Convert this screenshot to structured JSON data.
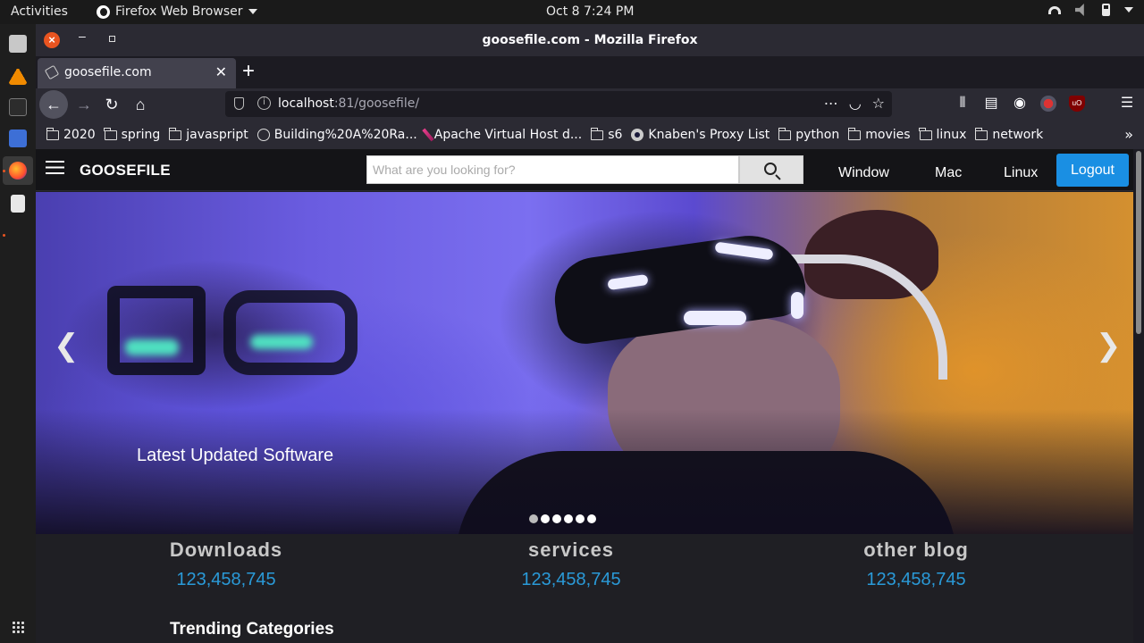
{
  "system": {
    "activities": "Activities",
    "app_menu": "Firefox Web Browser",
    "clock": "Oct 8   7:24 PM"
  },
  "window": {
    "title": "goosefile.com - Mozilla Firefox"
  },
  "tabs": [
    {
      "label": "goosefile.com"
    }
  ],
  "urlbar": {
    "host": "localhost",
    "rest": ":81/goosefile/"
  },
  "bookmarks": [
    {
      "label": "2020",
      "icon": "folder-icon"
    },
    {
      "label": "spring",
      "icon": "folder-icon"
    },
    {
      "label": "javaspript",
      "icon": "folder-icon"
    },
    {
      "label": "Building%20A%20Ra...",
      "icon": "globe-icon"
    },
    {
      "label": "Apache Virtual Host d...",
      "icon": "feather-icon"
    },
    {
      "label": "s6",
      "icon": "folder-icon"
    },
    {
      "label": "Knaben's Proxy List",
      "icon": "knaben-icon"
    },
    {
      "label": "python",
      "icon": "folder-icon"
    },
    {
      "label": "movies",
      "icon": "folder-icon"
    },
    {
      "label": "linux",
      "icon": "folder-icon"
    },
    {
      "label": "network",
      "icon": "folder-icon"
    }
  ],
  "site": {
    "brand": "GOOSEFILE",
    "search_placeholder": "What are you looking for?",
    "nav": {
      "window": "Window",
      "mac": "Mac",
      "linux": "Linux",
      "logout": "Logout"
    },
    "hero": {
      "caption": "Latest Updated Software",
      "prev": "❮",
      "next": "❯",
      "slide_count": 6,
      "active_slide": 1
    },
    "stats": [
      {
        "label": "Downloads",
        "value": "123,458,745"
      },
      {
        "label": "services",
        "value": "123,458,745"
      },
      {
        "label": "other blog",
        "value": "123,458,745"
      }
    ],
    "trending_title": "Trending Categories"
  },
  "colors": {
    "accent": "#1a8fe3",
    "stat_number": "#2a9ad8",
    "ubuntu_orange": "#e95420"
  }
}
